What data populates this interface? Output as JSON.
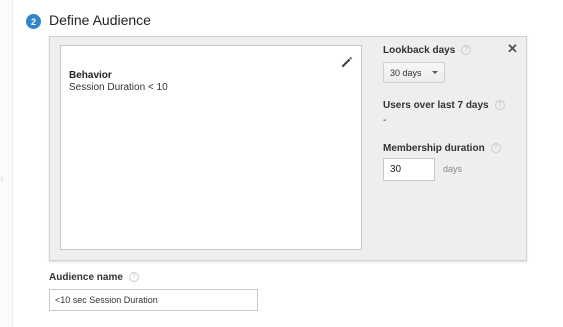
{
  "step": {
    "number": "2",
    "title": "Define Audience"
  },
  "definition": {
    "category": "Behavior",
    "condition": "Session Duration < 10",
    "edit_icon": "pencil-icon"
  },
  "close_icon": "close-icon",
  "lookback": {
    "label": "Lookback days",
    "help": "?",
    "selected": "30 days"
  },
  "users": {
    "label": "Users over last 7 days",
    "help": "?",
    "value": "-"
  },
  "membership": {
    "label": "Membership duration",
    "help": "?",
    "value": "30",
    "unit": "days"
  },
  "audience_name": {
    "label": "Audience name",
    "help": "?",
    "value": "<10 sec Session Duration"
  },
  "colors": {
    "accent": "#2e86c8",
    "panel_bg": "#eeeeee"
  }
}
